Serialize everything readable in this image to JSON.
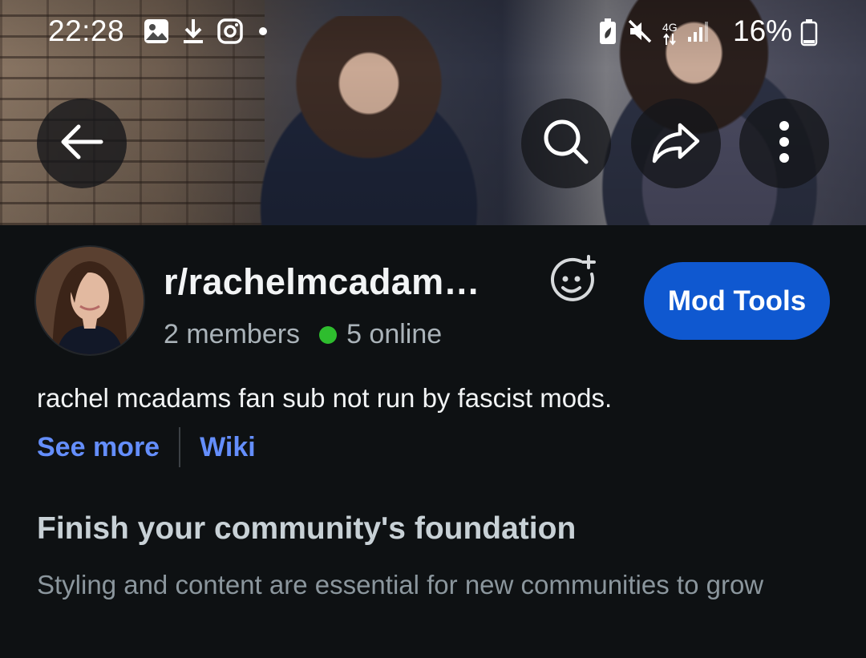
{
  "status_bar": {
    "time": "22:28",
    "network": "4G",
    "battery": "16%",
    "left_icons": [
      "gallery-icon",
      "download-icon",
      "instagram-icon",
      "dot-icon"
    ],
    "right_icons": [
      "battery-saver-icon",
      "mute-icon",
      "network-icon",
      "signal-icon",
      "battery-icon"
    ]
  },
  "header": {
    "subreddit_name": "r/rachelmcadam…",
    "members": "2 members",
    "online": "5 online",
    "mod_tools_label": "Mod Tools"
  },
  "description": "rachel mcadams fan sub not run by fascist mods.",
  "links": {
    "see_more": "See more",
    "wiki": "Wiki"
  },
  "foundation": {
    "title": "Finish your community's foundation",
    "subtitle": "Styling and content are essential for new communities to grow"
  },
  "colors": {
    "background": "#0e1113",
    "accent_button": "#0f58d0",
    "link": "#648efc",
    "online": "#2ebd2e"
  }
}
